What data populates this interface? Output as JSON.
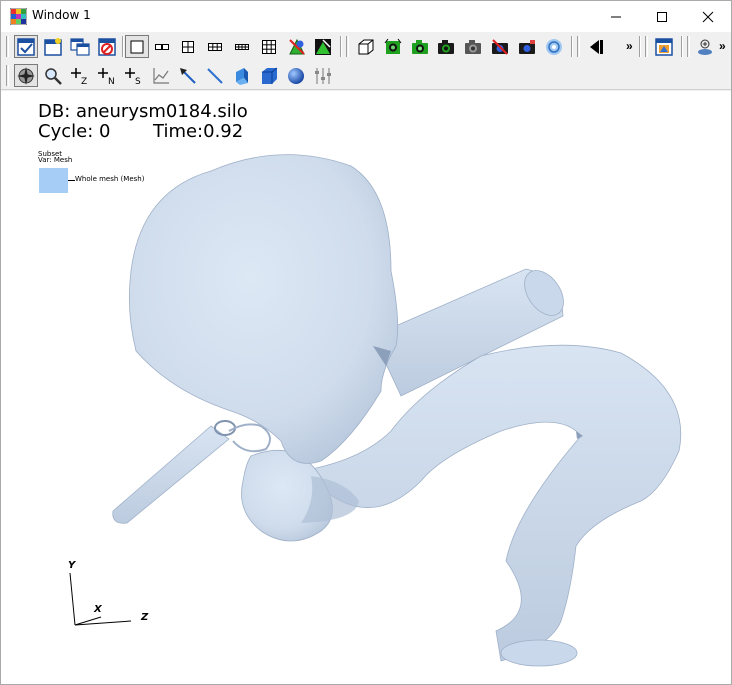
{
  "window": {
    "title": "Window 1",
    "controls": [
      "minimize-icon",
      "maximize-icon",
      "close-icon"
    ]
  },
  "toolbar1": {
    "buttons": [
      "toggle-window-active-icon",
      "new-window-icon",
      "clone-window-icon",
      "delete-window-icon",
      "layout-1x1-icon",
      "layout-1x2-icon",
      "layout-2x2-icon",
      "layout-2x3-icon",
      "layout-2x4-icon",
      "layout-3x3-icon",
      "lock-view-icon",
      "lock-time-icon",
      "bounding-box-icon",
      "spin-icon",
      "save-image-icon",
      "camera-icon",
      "camera-off-icon",
      "recenter-icon",
      "undo-view-icon",
      "perspective-icon",
      "reverse-play-icon",
      "more-chevron-icon",
      "invert-background-icon",
      "engine-icon",
      "more-chevron-icon"
    ],
    "overflow_label": "»"
  },
  "toolbar2": {
    "buttons": [
      "navigate-mode-icon",
      "zoom-mode-icon",
      "zone-pick-icon",
      "node-pick-icon",
      "spreadsheet-pick-icon",
      "curve-pick-icon",
      "line-out-icon",
      "line-tool-icon",
      "plane-tool-icon",
      "box-tool-icon",
      "sphere-tool-icon",
      "axis-restriction-icon"
    ],
    "labels": {
      "zone_pick": "Z",
      "node_pick": "N",
      "spreadsheet_pick": "S"
    }
  },
  "plot": {
    "db": "DB: aneurysm0184.silo",
    "cycle": "Cycle: 0",
    "time": "Time:0.92",
    "legend_title": "Subset",
    "legend_var": "Var: Mesh",
    "legend_item": "Whole mesh (Mesh)",
    "legend_color": "#a6cdf5",
    "mesh_color": "#cddbeb",
    "axes": {
      "y": "Y",
      "x": "X",
      "z": "Z"
    }
  }
}
